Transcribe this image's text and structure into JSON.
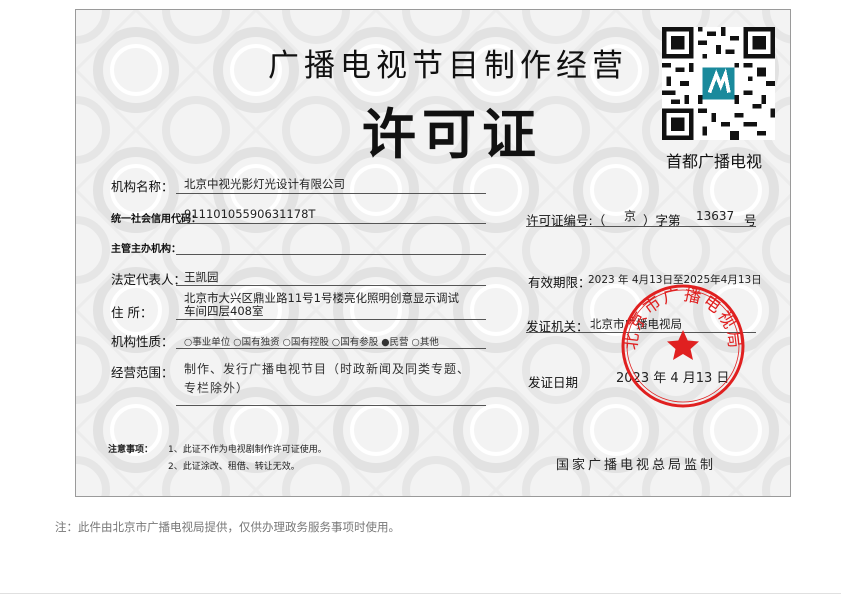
{
  "certificate": {
    "title_line1": "广播电视节目制作经营",
    "title_line2": "许可证",
    "qr_caption": "首都广播电视",
    "fields": {
      "org_name_label": "机构名称：",
      "org_name_value": "北京中视光影灯光设计有限公司",
      "credit_code_label": "统一社会信用代码：",
      "credit_code_value": "91110105590631178T",
      "supervisor_label": "主管主办机构：",
      "legal_rep_label": "法定代表人：",
      "legal_rep_value": "王凯园",
      "address_label": "住      所：",
      "address_line1": "北京市大兴区鼎业路11号1号楼亮化照明创意显示调试",
      "address_line2": "车间四层408室",
      "nature_label": "机构性质：",
      "nature_options": "○事业单位 ○国有独资 ○国有控股 ○国有参股 ●民营 ○其他",
      "scope_label": "经营范围：",
      "scope_line1": "制作、发行广播电视节目（时政新闻及同类专题、",
      "scope_line2": "专栏除外）"
    },
    "right_fields": {
      "license_no_label": "许可证编号:（",
      "license_region": "京",
      "license_mid": "）字第",
      "license_number": "13637",
      "license_suffix": "号",
      "validity_label": "有效期限：",
      "validity_value": "2023 年 4月13日至2025年4月13日",
      "issuer_label": "发证机关：",
      "issuer_value": "北京市广播电视局",
      "issue_date_label": "发证日期",
      "issue_date_value": "2023 年  4  月13 日"
    },
    "notice": {
      "label": "注意事项：",
      "item1": "1、此证不作为电视剧制作许可证使用。",
      "item2": "2、此证涂改、租借、转让无效。"
    },
    "authority": "国家广播电视总局监制",
    "seal_text": "北京市广播电视局",
    "seal_color": "#e02020"
  },
  "footnote": "注：此件由北京市广播电视局提供，仅供办理政务服务事项时使用。"
}
